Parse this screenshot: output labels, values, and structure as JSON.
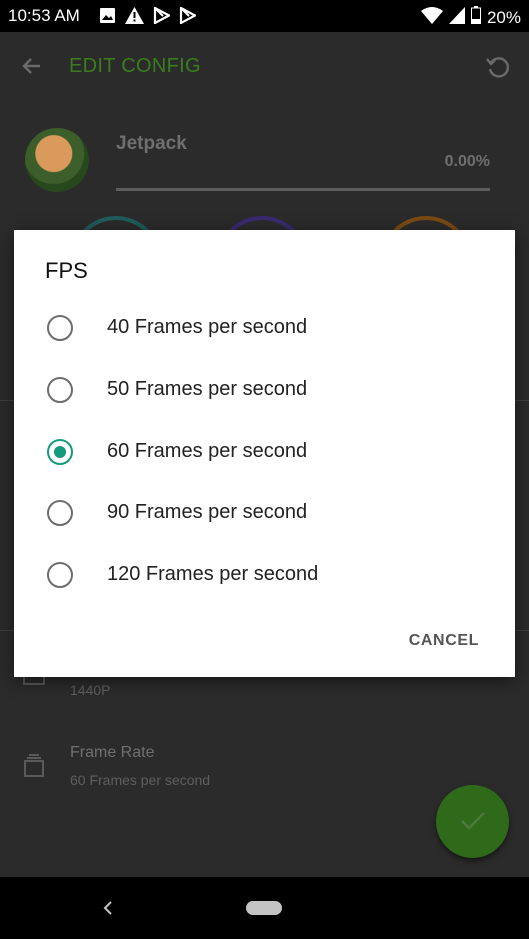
{
  "status_bar": {
    "time": "10:53 AM",
    "battery": "20%",
    "icons": [
      "image-icon",
      "warning-icon",
      "play-store-icon",
      "play-store-icon",
      "wifi-icon",
      "signal-icon",
      "battery-icon"
    ]
  },
  "app_bar": {
    "title": "EDIT CONFIG",
    "title_color": "#3a7d1c",
    "back_icon": "arrow-back-icon",
    "reset_icon": "restore-icon"
  },
  "game": {
    "name": "Jetpack",
    "percent": "0.00%",
    "progress": 0.0
  },
  "settings": {
    "resolution_value": "1440P",
    "frame_rate_label": "Frame Rate",
    "frame_rate_value": "60 Frames per second"
  },
  "dialog": {
    "title": "FPS",
    "options": [
      {
        "label": "40 Frames per second",
        "selected": false
      },
      {
        "label": "50 Frames per second",
        "selected": false
      },
      {
        "label": "60 Frames per second",
        "selected": true
      },
      {
        "label": "90 Frames per second",
        "selected": false
      },
      {
        "label": "120 Frames per second",
        "selected": false
      }
    ],
    "cancel_label": "CANCEL",
    "accent_color": "#169a7c"
  },
  "fab": {
    "icon": "check-icon",
    "color": "#2e6a1a"
  },
  "nav_bar": {
    "back_icon": "nav-back-icon",
    "home_icon": "nav-home-pill-icon"
  }
}
